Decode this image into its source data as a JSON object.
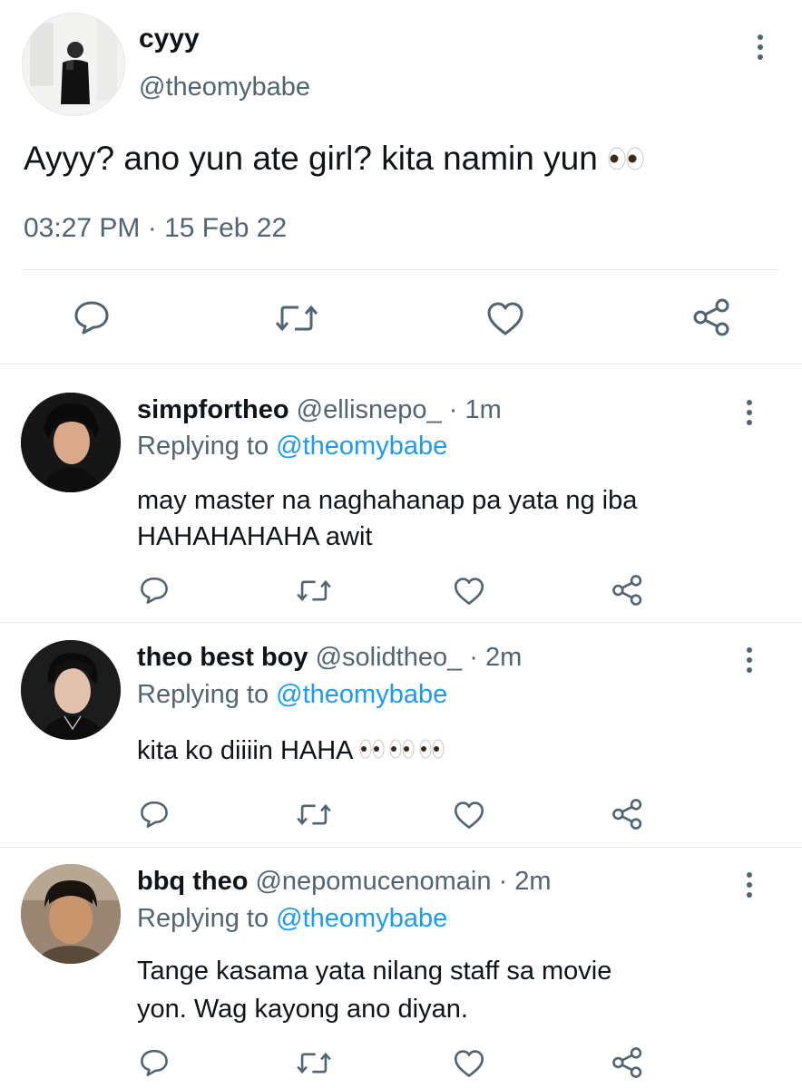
{
  "main_tweet": {
    "display_name": "cyyy",
    "handle": "@theomybabe",
    "text": "Ayyy? ano yun ate girl? kita namin yun",
    "emoji": "eyes-emoji",
    "timestamp": "03:27 PM · 15 Feb 22"
  },
  "replying_prefix": "Replying to",
  "replies": [
    {
      "display_name": "simpfortheo",
      "handle": "@ellisnepo_",
      "time": "· 1m",
      "replying_to": "@theomybabe",
      "text_line1": "may master na naghahanap pa yata ng iba",
      "text_line2": "HAHAHAHAHA awit"
    },
    {
      "display_name": "theo best boy",
      "handle": "@solidtheo_",
      "time": "· 2m",
      "replying_to": "@theomybabe",
      "text_line1": "kita ko diiiin HAHA",
      "text_line2": ""
    },
    {
      "display_name": "bbq theo",
      "handle": "@nepomucenomain",
      "time": "· 2m",
      "replying_to": "@theomybabe",
      "text_line1": "Tange kasama yata nilang staff sa movie",
      "text_line2": "yon. Wag kayong ano diyan."
    }
  ],
  "icons": [
    "reply-icon",
    "retweet-icon",
    "like-icon",
    "share-icon",
    "more-icon"
  ],
  "colors": {
    "link": "#1d9bf0",
    "muted": "#536471",
    "text": "#0f1419",
    "divider": "#e6e9ec"
  }
}
